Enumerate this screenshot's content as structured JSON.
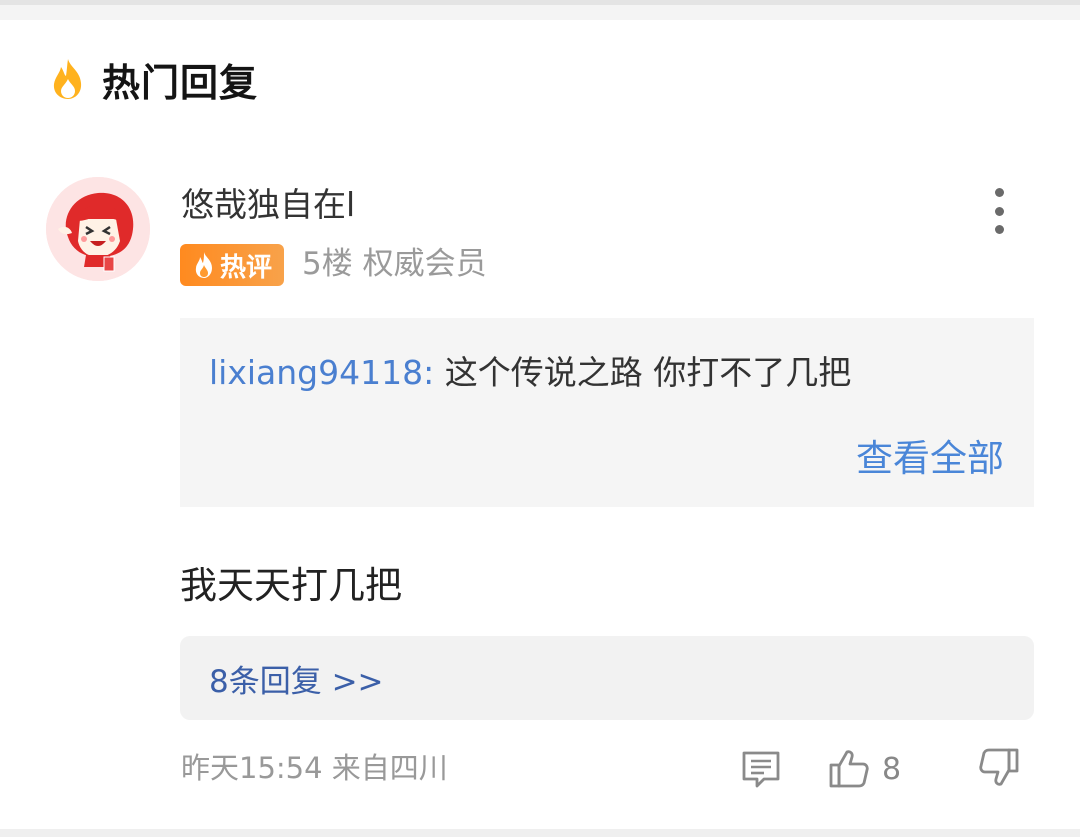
{
  "section": {
    "title": "热门回复",
    "icon": "fire-icon",
    "icon_color": "#ffb21e"
  },
  "comment": {
    "username": "悠哉独自在l",
    "hot_badge": "热评",
    "floor": "5楼",
    "member_level": "权威会员",
    "quote": {
      "user": "lixiang94118:",
      "text": "这个传说之路 你打不了几把",
      "view_all": "查看全部"
    },
    "body": "我天天打几把",
    "replies_link": "8条回复 >>",
    "time": "昨天15:54",
    "location": "来自四川",
    "like_count": "8"
  },
  "colors": {
    "link_blue": "#4a86d8",
    "badge_orange": "#ff8a1f",
    "reply_blue": "#3b5fa8"
  }
}
